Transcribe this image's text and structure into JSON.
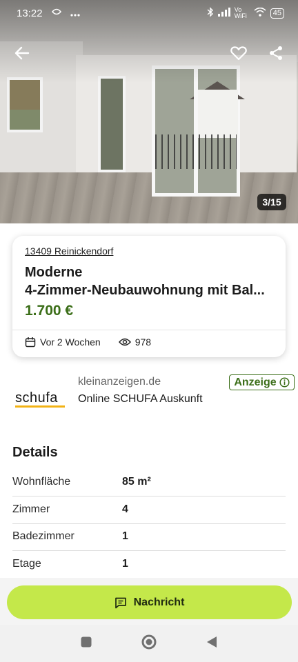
{
  "status_bar": {
    "time": "13:22",
    "network": "Vo WiFi",
    "battery": "45"
  },
  "photo": {
    "counter": "3/15"
  },
  "listing": {
    "location": "13409 Reinickendorf",
    "title_line1": "Moderne",
    "title_line2": "4-Zimmer-Neubauwohnung mit Bal...",
    "price": "1.700 €",
    "posted": "Vor 2 Wochen",
    "views": "978"
  },
  "ad": {
    "domain": "kleinanzeigen.de",
    "badge": "Anzeige",
    "logo_text": "schufa",
    "title": "Online SCHUFA Auskunft"
  },
  "details": {
    "heading": "Details",
    "rows": [
      {
        "label": "Wohnfläche",
        "value": "85 m²"
      },
      {
        "label": "Zimmer",
        "value": "4"
      },
      {
        "label": "Badezimmer",
        "value": "1"
      },
      {
        "label": "Etage",
        "value": "1"
      }
    ]
  },
  "actions": {
    "message_label": "Nachricht"
  },
  "colors": {
    "accent": "#c4e84a",
    "price_green": "#3b6e18"
  }
}
